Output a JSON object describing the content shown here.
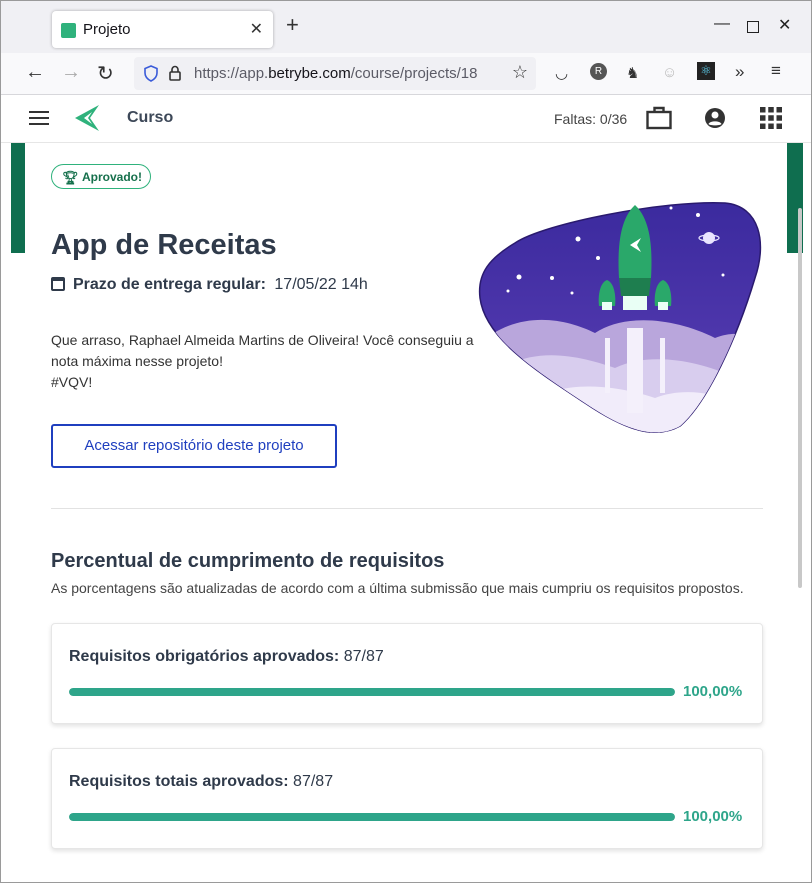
{
  "browser": {
    "tab_title": "Projeto",
    "url_prefix": "https://app.",
    "url_domain": "betrybe.com",
    "url_path": "/course/projects/18"
  },
  "header": {
    "title": "Curso",
    "faltas": "Faltas: 0/36"
  },
  "project": {
    "badge": "Aprovado!",
    "title": "App de Receitas",
    "deadline_label": "Prazo de entrega regular:",
    "deadline_value": "17/05/22 14h",
    "message_line1": "Que arraso, Raphael Almeida Martins de Oliveira! Você conseguiu a",
    "message_line2": "nota máxima nesse projeto!",
    "message_line3": "#VQV!",
    "repo_button": "Acessar repositório deste projeto"
  },
  "requirements": {
    "title": "Percentual de cumprimento de requisitos",
    "subtitle": "As porcentagens são atualizadas de acordo com a última submissão que mais cumpriu os requisitos propostos.",
    "cards": [
      {
        "label": "Requisitos obrigatórios aprovados:",
        "value": "87/87",
        "percent_text": "100,00%",
        "progress": 1.0
      },
      {
        "label": "Requisitos totais aprovados:",
        "value": "87/87",
        "percent_text": "100,00%",
        "progress": 1.0
      }
    ]
  },
  "colors": {
    "brand_green": "#2fb27c",
    "progress_green": "#2ea58a",
    "link_blue": "#1f3fbf",
    "dark_green": "#0f6e4f"
  }
}
